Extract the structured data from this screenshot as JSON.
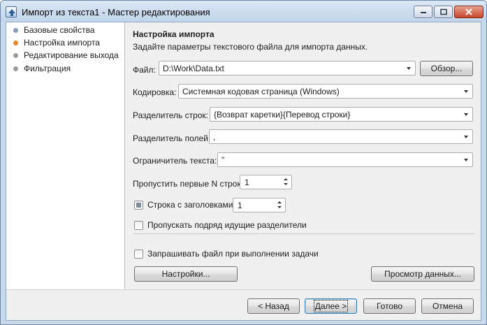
{
  "window": {
    "title": "Импорт из текста1 - Мастер редактирования"
  },
  "sidebar": {
    "items": [
      {
        "label": "Базовые свойства",
        "state": "done"
      },
      {
        "label": "Настройка импорта",
        "state": "active"
      },
      {
        "label": "Редактирование выхода",
        "state": "pending"
      },
      {
        "label": "Фильтрация",
        "state": "pending"
      }
    ]
  },
  "main": {
    "title": "Настройка импорта",
    "description": "Задайте параметры текстового файла для импорта данных.",
    "file": {
      "label": "Файл:",
      "value": "D:\\Work\\Data.txt",
      "browse_label": "Обзор..."
    },
    "encoding": {
      "label": "Кодировка:",
      "value": "Системная кодовая страница (Windows)"
    },
    "row_separator": {
      "label": "Разделитель строк:",
      "value": "{Возврат каретки}{Перевод строки}"
    },
    "field_separator": {
      "label": "Разделитель полей:",
      "value": ","
    },
    "text_qualifier": {
      "label": "Ограничитель текста:",
      "value": "\""
    },
    "skip_first_rows": {
      "label": "Пропустить первые N строк:",
      "value": "1"
    },
    "header_row": {
      "label": "Строка с заголовками:",
      "value": "1",
      "checked": "indeterminate"
    },
    "skip_consecutive": {
      "label": "Пропускать подряд идущие разделители",
      "checked": false
    },
    "ask_file": {
      "label": "Запрашивать файл при выполнении задачи",
      "checked": false
    },
    "settings_button": "Настройки...",
    "preview_button": "Просмотр данных..."
  },
  "footer": {
    "back": "< Назад",
    "next": "Далее >",
    "finish": "Готово",
    "cancel": "Отмена"
  },
  "colors": {
    "active_step": "#e8862a",
    "done_step": "#8a9fb6",
    "pending_step": "#9c9c9c",
    "close_button": "#c9452b"
  }
}
